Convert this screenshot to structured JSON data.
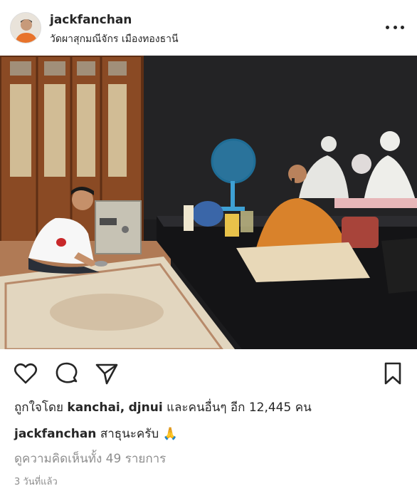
{
  "post": {
    "username": "jackfanchan",
    "location": "วัดผาสุกมณีจักร เมืองทองธานี",
    "icons": {
      "more": "more-horizontal-icon",
      "like": "heart-icon",
      "comment": "comment-icon",
      "share": "send-icon",
      "save": "bookmark-icon"
    },
    "likes": {
      "prefix": "ถูกใจโดย",
      "user1": "kanchai,",
      "user2": "djnui",
      "suffix": "และคนอื่นๆ อีก 12,445 คน"
    },
    "caption": {
      "username": "jackfanchan",
      "text": "สาธุนะครับ 🙏"
    },
    "comments_link": "ดูความคิดเห็นทั้ง 49 รายการ",
    "timestamp": "3 วันที่แล้ว"
  },
  "colors": {
    "text": "#262626",
    "muted": "#8e8e8e",
    "robe": "#d9822b"
  }
}
